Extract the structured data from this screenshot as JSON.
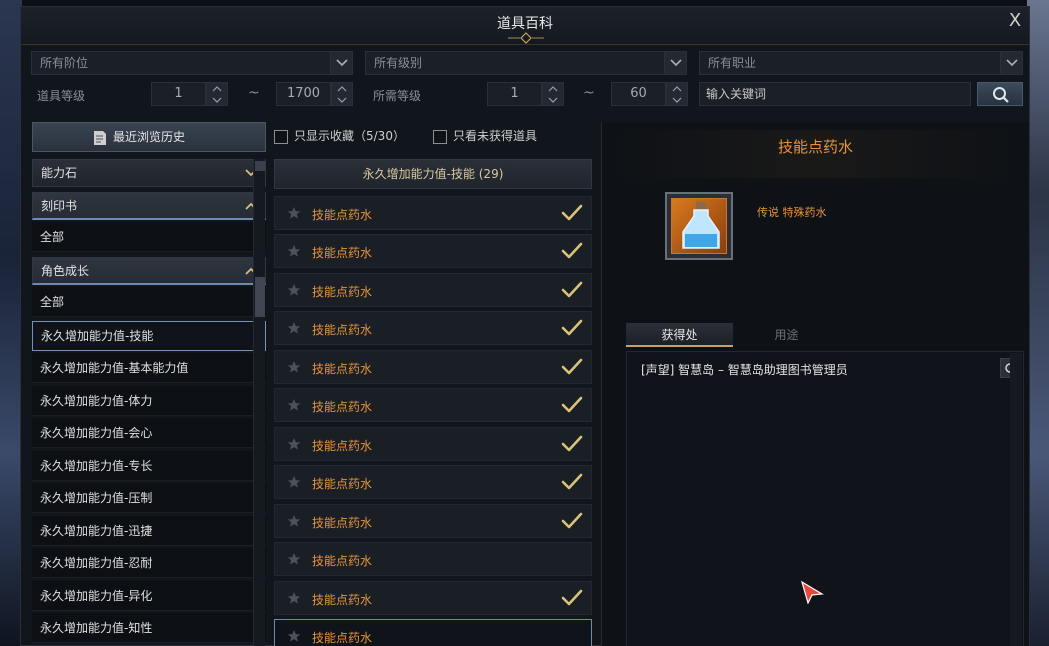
{
  "window": {
    "title": "道具百科",
    "close_label": "X"
  },
  "filters": {
    "tier_dropdown": "所有阶位",
    "grade_dropdown": "所有级别",
    "class_dropdown": "所有职业",
    "item_level_label": "道具等级",
    "item_level_min": "1",
    "item_level_max": "1700",
    "required_level_label": "所需等级",
    "required_level_min": "1",
    "required_level_max": "60",
    "range_separator": "~",
    "search_placeholder": "输入关键词"
  },
  "left_panel": {
    "history_button": "最近浏览历史",
    "categories": [
      {
        "label": "能力石",
        "expanded": false
      },
      {
        "label": "刻印书",
        "expanded": true
      },
      {
        "label": "角色成长",
        "expanded": true
      }
    ],
    "engraving_sub": [
      "全部"
    ],
    "growth_sub": [
      "全部",
      "永久增加能力值-技能",
      "永久增加能力值-基本能力值",
      "永久增加能力值-体力",
      "永久增加能力值-会心",
      "永久增加能力值-专长",
      "永久增加能力值-压制",
      "永久增加能力值-迅捷",
      "永久增加能力值-忍耐",
      "永久增加能力值-异化",
      "永久增加能力值-知性"
    ],
    "selected_sub": "永久增加能力值-技能"
  },
  "middle_panel": {
    "show_favorites_label": "只显示收藏（5/30）",
    "show_unobtained_label": "只看未获得道具",
    "list_header": "永久增加能力值-技能 (29)",
    "items": [
      {
        "name": "技能点药水",
        "obtained": true
      },
      {
        "name": "技能点药水",
        "obtained": true
      },
      {
        "name": "技能点药水",
        "obtained": true
      },
      {
        "name": "技能点药水",
        "obtained": true
      },
      {
        "name": "技能点药水",
        "obtained": true
      },
      {
        "name": "技能点药水",
        "obtained": true
      },
      {
        "name": "技能点药水",
        "obtained": true
      },
      {
        "name": "技能点药水",
        "obtained": true
      },
      {
        "name": "技能点药水",
        "obtained": true
      },
      {
        "name": "技能点药水",
        "obtained": false
      },
      {
        "name": "技能点药水",
        "obtained": true
      },
      {
        "name": "技能点药水",
        "obtained": false
      }
    ]
  },
  "right_panel": {
    "item_name": "技能点药水",
    "grade_text": "传说 特殊药水",
    "tab_source": "获得处",
    "tab_usage": "用途",
    "source_entry": "[声望] 智慧岛 – 智慧岛助理图书管理员"
  },
  "colors": {
    "accent_orange": "#e6943c",
    "selection_blue": "#7792b8",
    "check_gold": "#d9c27a"
  }
}
